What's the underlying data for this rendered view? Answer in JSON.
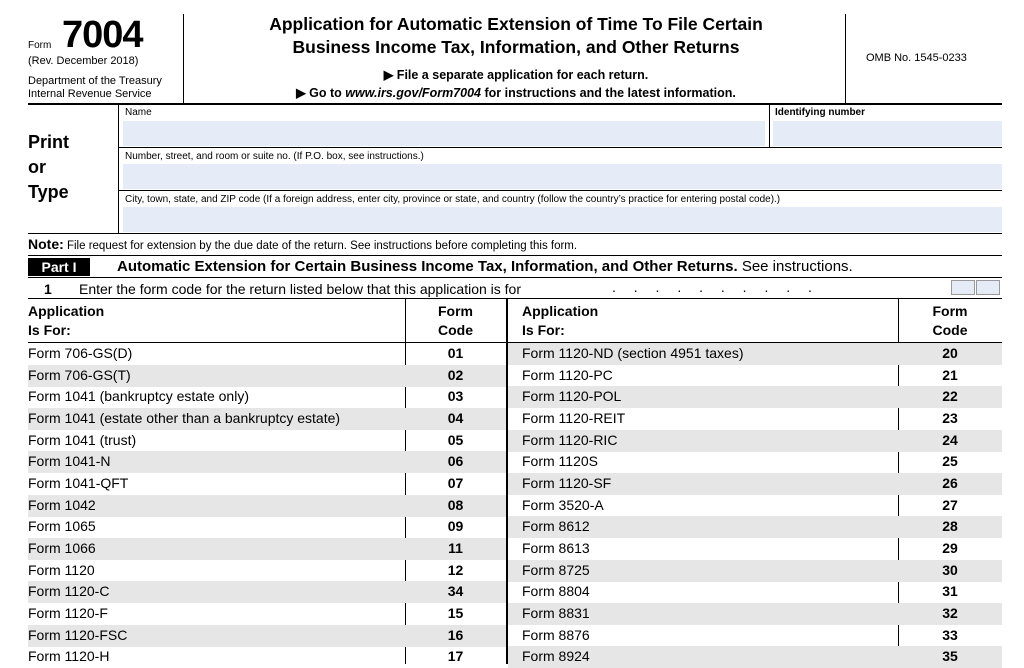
{
  "header": {
    "form_label": "Form",
    "form_number": "7004",
    "revision": "(Rev. December 2018)",
    "department": "Department of the Treasury",
    "service": "Internal Revenue Service",
    "title_line1": "Application for Automatic Extension of Time To File Certain",
    "title_line2": "Business Income Tax, Information, and Other Returns",
    "instruction1": "▶ File a separate application for each return.",
    "instruction2_prefix": "▶ Go to ",
    "instruction2_url": "www.irs.gov/Form7004",
    "instruction2_suffix": " for instructions and the latest information.",
    "omb": "OMB No. 1545-0233"
  },
  "taxpayer": {
    "print_line1": "Print",
    "print_line2": "or",
    "print_line3": "Type",
    "name_label": "Name",
    "id_label": "Identifying number",
    "address_label": "Number, street, and room or suite no. (If P.O. box, see instructions.)",
    "city_label": "City, town, state, and ZIP code (If a foreign address, enter city, province or state, and country (follow the country’s practice for entering postal code).)"
  },
  "note": {
    "label": "Note:",
    "text": " File request for extension by the due date of the return. See instructions before completing this form."
  },
  "part1": {
    "tag": "Part I",
    "title": "Automatic Extension for Certain Business Income Tax, Information, and Other Returns.",
    "title_suffix": " See instructions.",
    "line1_num": "1",
    "line1_text": "Enter the form code for the return listed below that this application is for",
    "line1_dots": ". . . . . . . . . ."
  },
  "table": {
    "col_app_line1": "Application",
    "col_app_line2": "Is For:",
    "col_code_line1": "Form",
    "col_code_line2": "Code",
    "left_rows": [
      {
        "name": "Form 706-GS(D)",
        "code": "01"
      },
      {
        "name": "Form 706-GS(T)",
        "code": "02"
      },
      {
        "name": "Form 1041 (bankruptcy estate only)",
        "code": "03"
      },
      {
        "name": "Form 1041 (estate other than a bankruptcy estate)",
        "code": "04"
      },
      {
        "name": "Form 1041 (trust)",
        "code": "05"
      },
      {
        "name": "Form 1041-N",
        "code": "06"
      },
      {
        "name": "Form 1041-QFT",
        "code": "07"
      },
      {
        "name": "Form 1042",
        "code": "08"
      },
      {
        "name": "Form 1065",
        "code": "09"
      },
      {
        "name": "Form 1066",
        "code": "11"
      },
      {
        "name": "Form 1120",
        "code": "12"
      },
      {
        "name": "Form 1120-C",
        "code": "34"
      },
      {
        "name": "Form 1120-F",
        "code": "15"
      },
      {
        "name": "Form 1120-FSC",
        "code": "16"
      },
      {
        "name": "Form 1120-H",
        "code": "17"
      }
    ],
    "right_rows": [
      {
        "name": "Form 1120-ND (section 4951 taxes)",
        "code": "20"
      },
      {
        "name": "Form 1120-PC",
        "code": "21"
      },
      {
        "name": "Form 1120-POL",
        "code": "22"
      },
      {
        "name": "Form 1120-REIT",
        "code": "23"
      },
      {
        "name": "Form 1120-RIC",
        "code": "24"
      },
      {
        "name": "Form 1120S",
        "code": "25"
      },
      {
        "name": "Form 1120-SF",
        "code": "26"
      },
      {
        "name": "Form 3520-A",
        "code": "27"
      },
      {
        "name": "Form 8612",
        "code": "28"
      },
      {
        "name": "Form 8613",
        "code": "29"
      },
      {
        "name": "Form 8725",
        "code": "30"
      },
      {
        "name": "Form 8804",
        "code": "31"
      },
      {
        "name": "Form 8831",
        "code": "32"
      },
      {
        "name": "Form 8876",
        "code": "33"
      },
      {
        "name": "Form 8924",
        "code": "35"
      }
    ]
  }
}
